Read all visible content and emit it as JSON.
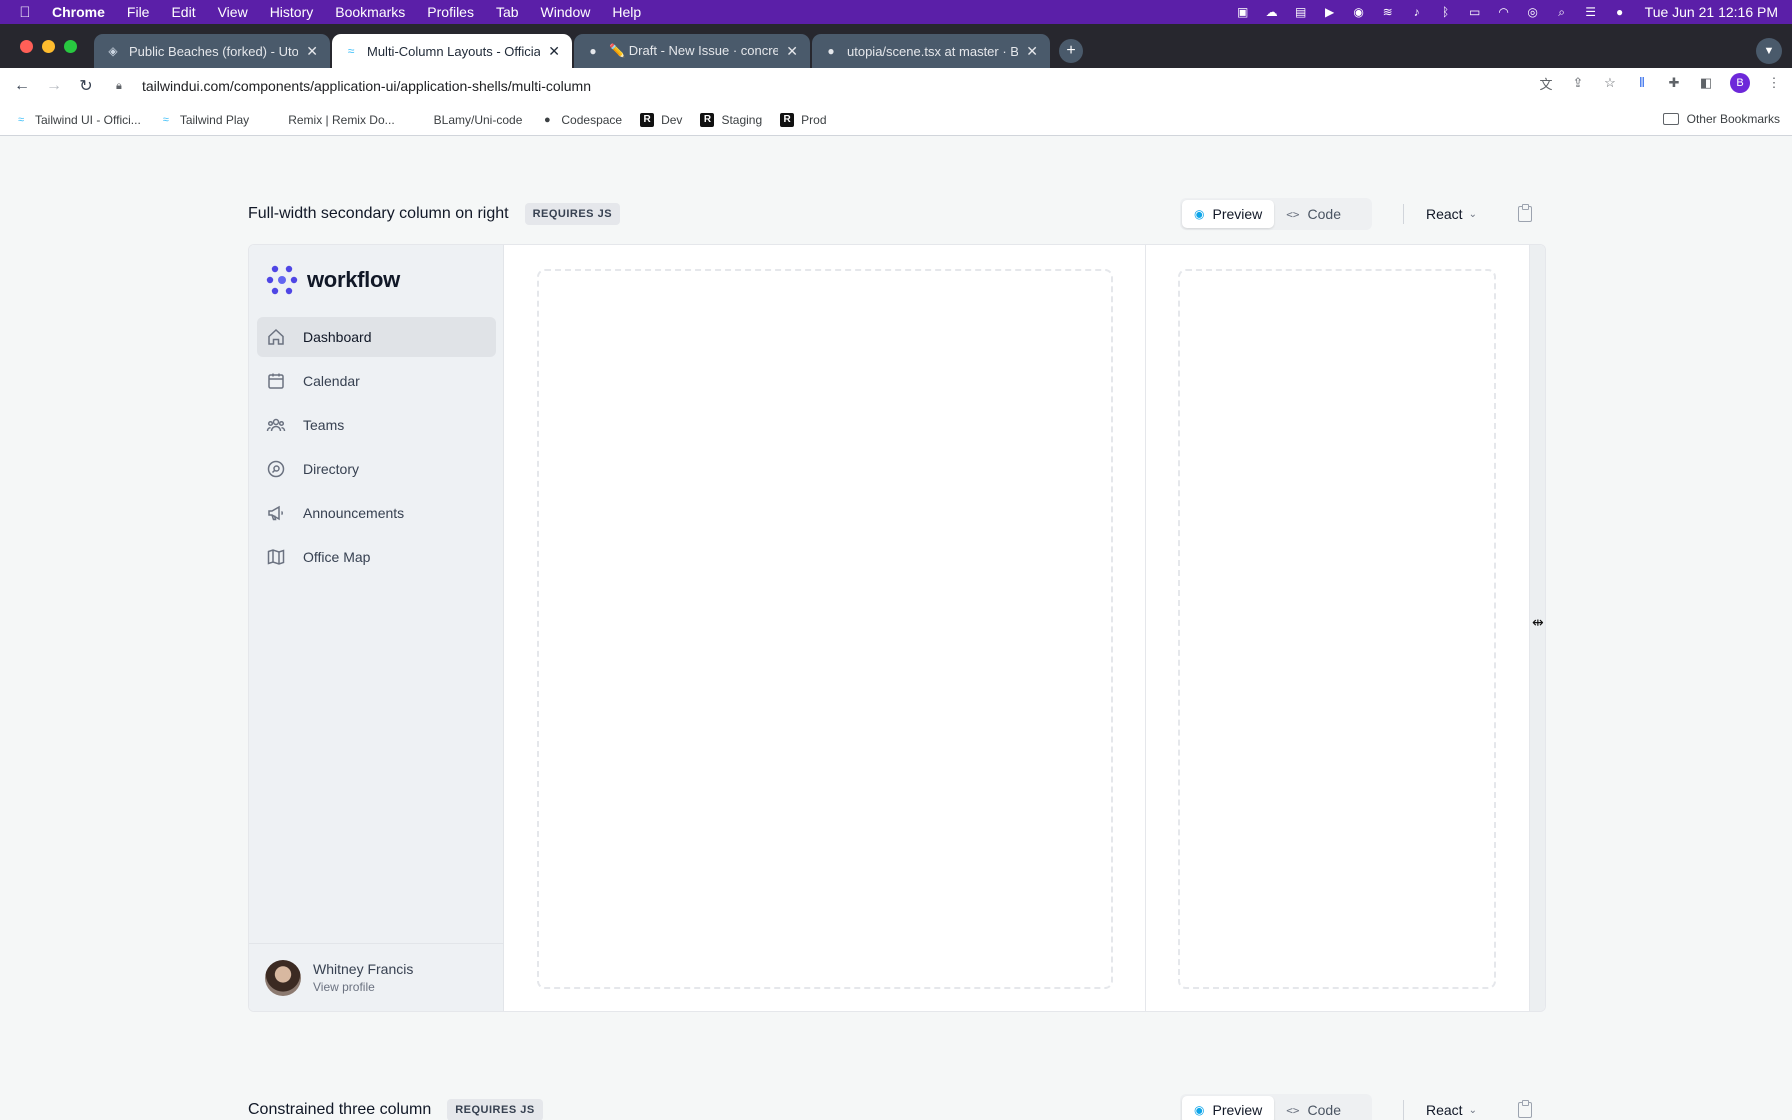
{
  "menubar": {
    "app": "Chrome",
    "items": [
      "File",
      "Edit",
      "View",
      "History",
      "Bookmarks",
      "Profiles",
      "Tab",
      "Window",
      "Help"
    ],
    "clock": "Tue Jun 21  12:16 PM"
  },
  "tabs": [
    {
      "title": "Public Beaches (forked) - Utop",
      "icon": "utopia-icon",
      "active": false
    },
    {
      "title": "Multi-Column Layouts - Officia",
      "icon": "tailwind-icon",
      "active": true
    },
    {
      "title": "✏️ Draft - New Issue · concrete",
      "icon": "github-icon",
      "active": false
    },
    {
      "title": "utopia/scene.tsx at master · BL",
      "icon": "github-icon",
      "active": false
    }
  ],
  "toolbar": {
    "url": "tailwindui.com/components/application-ui/application-shells/multi-column",
    "profile_initial": "B"
  },
  "bookmarks": [
    {
      "label": "Tailwind UI - Offici...",
      "icon": "tailwind-icon"
    },
    {
      "label": "Tailwind Play",
      "icon": "tailwind-icon"
    },
    {
      "label": "Remix | Remix Do...",
      "icon": "remix-icon"
    },
    {
      "label": "BLamy/Uni-code",
      "icon": "blank-icon"
    },
    {
      "label": "Codespace",
      "icon": "github-icon"
    },
    {
      "label": "Dev",
      "icon": "remix-icon"
    },
    {
      "label": "Staging",
      "icon": "remix-icon"
    },
    {
      "label": "Prod",
      "icon": "remix-icon"
    }
  ],
  "other_bookmarks": "Other Bookmarks",
  "section1": {
    "title": "Full-width secondary column on right",
    "badge": "REQUIRES JS",
    "preview_label": "Preview",
    "code_label": "Code",
    "framework": "React"
  },
  "preview": {
    "brand": "workflow",
    "nav": [
      {
        "label": "Dashboard",
        "icon": "home-icon",
        "active": true
      },
      {
        "label": "Calendar",
        "icon": "calendar-icon",
        "active": false
      },
      {
        "label": "Teams",
        "icon": "users-icon",
        "active": false
      },
      {
        "label": "Directory",
        "icon": "search-circle-icon",
        "active": false
      },
      {
        "label": "Announcements",
        "icon": "megaphone-icon",
        "active": false
      },
      {
        "label": "Office Map",
        "icon": "map-icon",
        "active": false
      }
    ],
    "user_name": "Whitney Francis",
    "user_link": "View profile"
  },
  "section2": {
    "title": "Constrained three column",
    "badge": "REQUIRES JS",
    "preview_label": "Preview",
    "code_label": "Code",
    "framework": "React"
  },
  "colors": {
    "menubar": "#5b1fa8",
    "accent": "#4f46e5",
    "preview_icon": "#0ea5e9"
  }
}
